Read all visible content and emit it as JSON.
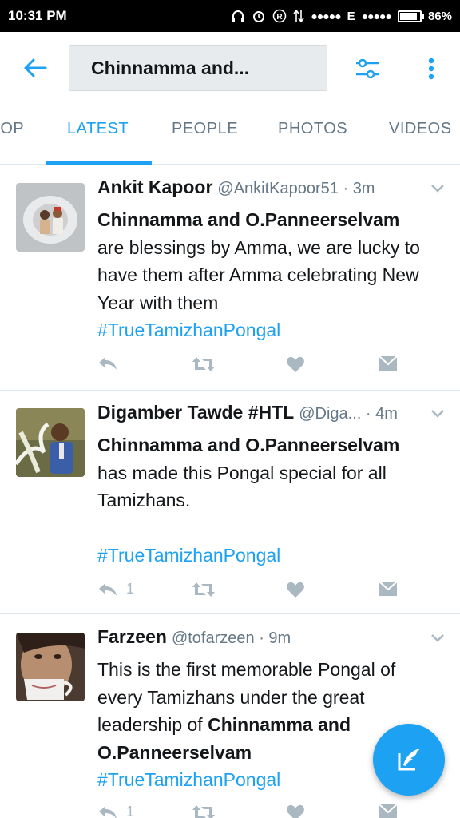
{
  "status_bar": {
    "time": "10:31 PM",
    "network": "E",
    "battery": "86%"
  },
  "search": {
    "query": "Chinnamma and..."
  },
  "tabs": [
    {
      "label": "TOP"
    },
    {
      "label": "LATEST"
    },
    {
      "label": "PEOPLE"
    },
    {
      "label": "PHOTOS"
    },
    {
      "label": "VIDEOS"
    }
  ],
  "tweets": [
    {
      "name": "Ankit Kapoor",
      "handle": "@AnkitKapoor51",
      "time": "3m",
      "bold_lead": "Chinnamma and O.Panneerselvam",
      "text": "are blessings by Amma, we are lucky to have them after Amma celebrating New Year with them",
      "hashtag": "#TrueTamizhanPongal",
      "retweet_count": ""
    },
    {
      "name": "Digamber Tawde #HTL",
      "handle": "@Diga...",
      "time": "4m",
      "bold_lead": "Chinnamma and O.Panneerselvam",
      "text": "has made this Pongal special for all Tamizhans.",
      "hashtag": "#TrueTamizhanPongal",
      "reply_count": "1"
    },
    {
      "name": "Farzeen",
      "handle": "@tofarzeen",
      "time": "9m",
      "text": "This is the first memorable Pongal of every Tamizhans under the great leadership of",
      "bold_tail": "Chinnamma and O.Panneerselvam",
      "hashtag": "#TrueTamizhanPongal",
      "reply_count": "1"
    }
  ],
  "colors": {
    "accent": "#1da1f2",
    "secondary_text": "#657786",
    "icon_gray": "#aab8c2"
  },
  "icons": [
    "back-arrow-icon",
    "filter-icon",
    "more-vert-icon",
    "reply-icon",
    "retweet-icon",
    "like-icon",
    "dm-icon",
    "compose-icon"
  ]
}
